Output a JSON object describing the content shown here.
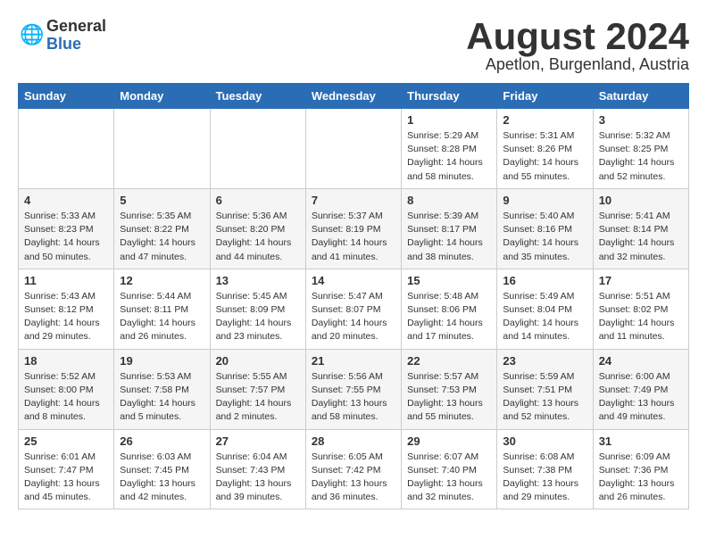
{
  "header": {
    "logo": {
      "general": "General",
      "blue": "Blue"
    },
    "month": "August 2024",
    "location": "Apetlon, Burgenland, Austria"
  },
  "weekdays": [
    "Sunday",
    "Monday",
    "Tuesday",
    "Wednesday",
    "Thursday",
    "Friday",
    "Saturday"
  ],
  "weeks": [
    [
      {
        "day": "",
        "info": ""
      },
      {
        "day": "",
        "info": ""
      },
      {
        "day": "",
        "info": ""
      },
      {
        "day": "",
        "info": ""
      },
      {
        "day": "1",
        "info": "Sunrise: 5:29 AM\nSunset: 8:28 PM\nDaylight: 14 hours\nand 58 minutes."
      },
      {
        "day": "2",
        "info": "Sunrise: 5:31 AM\nSunset: 8:26 PM\nDaylight: 14 hours\nand 55 minutes."
      },
      {
        "day": "3",
        "info": "Sunrise: 5:32 AM\nSunset: 8:25 PM\nDaylight: 14 hours\nand 52 minutes."
      }
    ],
    [
      {
        "day": "4",
        "info": "Sunrise: 5:33 AM\nSunset: 8:23 PM\nDaylight: 14 hours\nand 50 minutes."
      },
      {
        "day": "5",
        "info": "Sunrise: 5:35 AM\nSunset: 8:22 PM\nDaylight: 14 hours\nand 47 minutes."
      },
      {
        "day": "6",
        "info": "Sunrise: 5:36 AM\nSunset: 8:20 PM\nDaylight: 14 hours\nand 44 minutes."
      },
      {
        "day": "7",
        "info": "Sunrise: 5:37 AM\nSunset: 8:19 PM\nDaylight: 14 hours\nand 41 minutes."
      },
      {
        "day": "8",
        "info": "Sunrise: 5:39 AM\nSunset: 8:17 PM\nDaylight: 14 hours\nand 38 minutes."
      },
      {
        "day": "9",
        "info": "Sunrise: 5:40 AM\nSunset: 8:16 PM\nDaylight: 14 hours\nand 35 minutes."
      },
      {
        "day": "10",
        "info": "Sunrise: 5:41 AM\nSunset: 8:14 PM\nDaylight: 14 hours\nand 32 minutes."
      }
    ],
    [
      {
        "day": "11",
        "info": "Sunrise: 5:43 AM\nSunset: 8:12 PM\nDaylight: 14 hours\nand 29 minutes."
      },
      {
        "day": "12",
        "info": "Sunrise: 5:44 AM\nSunset: 8:11 PM\nDaylight: 14 hours\nand 26 minutes."
      },
      {
        "day": "13",
        "info": "Sunrise: 5:45 AM\nSunset: 8:09 PM\nDaylight: 14 hours\nand 23 minutes."
      },
      {
        "day": "14",
        "info": "Sunrise: 5:47 AM\nSunset: 8:07 PM\nDaylight: 14 hours\nand 20 minutes."
      },
      {
        "day": "15",
        "info": "Sunrise: 5:48 AM\nSunset: 8:06 PM\nDaylight: 14 hours\nand 17 minutes."
      },
      {
        "day": "16",
        "info": "Sunrise: 5:49 AM\nSunset: 8:04 PM\nDaylight: 14 hours\nand 14 minutes."
      },
      {
        "day": "17",
        "info": "Sunrise: 5:51 AM\nSunset: 8:02 PM\nDaylight: 14 hours\nand 11 minutes."
      }
    ],
    [
      {
        "day": "18",
        "info": "Sunrise: 5:52 AM\nSunset: 8:00 PM\nDaylight: 14 hours\nand 8 minutes."
      },
      {
        "day": "19",
        "info": "Sunrise: 5:53 AM\nSunset: 7:58 PM\nDaylight: 14 hours\nand 5 minutes."
      },
      {
        "day": "20",
        "info": "Sunrise: 5:55 AM\nSunset: 7:57 PM\nDaylight: 14 hours\nand 2 minutes."
      },
      {
        "day": "21",
        "info": "Sunrise: 5:56 AM\nSunset: 7:55 PM\nDaylight: 13 hours\nand 58 minutes."
      },
      {
        "day": "22",
        "info": "Sunrise: 5:57 AM\nSunset: 7:53 PM\nDaylight: 13 hours\nand 55 minutes."
      },
      {
        "day": "23",
        "info": "Sunrise: 5:59 AM\nSunset: 7:51 PM\nDaylight: 13 hours\nand 52 minutes."
      },
      {
        "day": "24",
        "info": "Sunrise: 6:00 AM\nSunset: 7:49 PM\nDaylight: 13 hours\nand 49 minutes."
      }
    ],
    [
      {
        "day": "25",
        "info": "Sunrise: 6:01 AM\nSunset: 7:47 PM\nDaylight: 13 hours\nand 45 minutes."
      },
      {
        "day": "26",
        "info": "Sunrise: 6:03 AM\nSunset: 7:45 PM\nDaylight: 13 hours\nand 42 minutes."
      },
      {
        "day": "27",
        "info": "Sunrise: 6:04 AM\nSunset: 7:43 PM\nDaylight: 13 hours\nand 39 minutes."
      },
      {
        "day": "28",
        "info": "Sunrise: 6:05 AM\nSunset: 7:42 PM\nDaylight: 13 hours\nand 36 minutes."
      },
      {
        "day": "29",
        "info": "Sunrise: 6:07 AM\nSunset: 7:40 PM\nDaylight: 13 hours\nand 32 minutes."
      },
      {
        "day": "30",
        "info": "Sunrise: 6:08 AM\nSunset: 7:38 PM\nDaylight: 13 hours\nand 29 minutes."
      },
      {
        "day": "31",
        "info": "Sunrise: 6:09 AM\nSunset: 7:36 PM\nDaylight: 13 hours\nand 26 minutes."
      }
    ]
  ]
}
